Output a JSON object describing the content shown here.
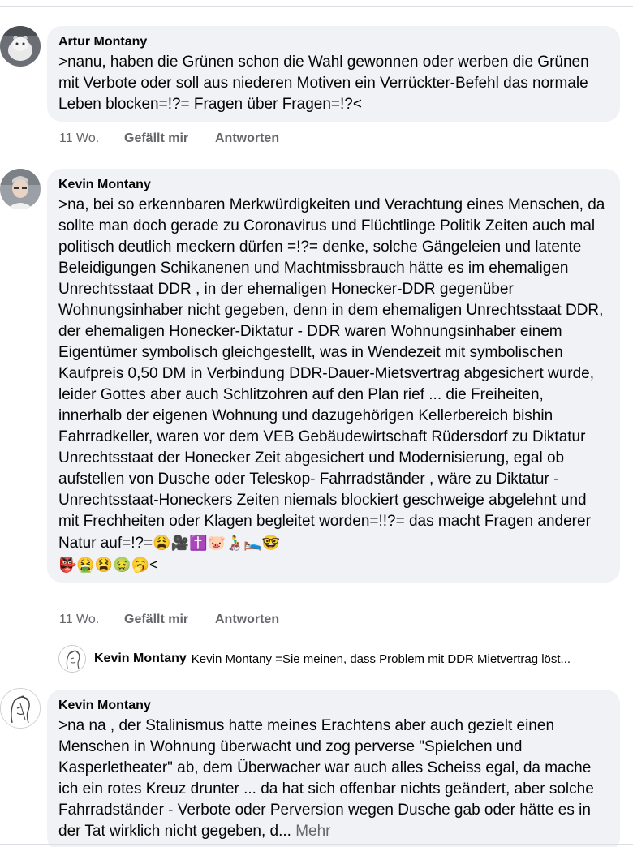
{
  "comments": [
    {
      "author": "Artur Montany",
      "text": ">nanu, haben die Grünen schon die Wahl gewonnen oder werben die Grünen mit Verbote oder soll aus niederen Motiven  ein Verrückter-Befehl das normale Leben blocken=!?= Fragen über Fragen=!?<",
      "time": "11 Wo.",
      "like": "Gefällt mir",
      "reply": "Antworten"
    },
    {
      "author": "Kevin Montany",
      "text": ">na, bei so erkennbaren Merkwürdigkeiten und Verachtung eines Menschen, da sollte man doch gerade zu Coronavirus und Flüchtlinge Politik Zeiten  auch mal politisch deutlich meckern dürfen =!?= denke, solche Gängeleien und latente Beleidigungen Schikanenen und Machtmissbrauch  hätte es im ehemaligen Unrechtsstaat DDR  , in der ehemaligen Honecker-DDR gegenüber Wohnungsinhaber nicht gegeben, denn in dem ehemaligen Unrechtsstaat DDR, der ehemaligen Honecker-Diktatur - DDR waren Wohnungsinhaber einem Eigentümer symbolisch gleichgestellt, was in Wendezeit mit symbolischen  Kaufpreis 0,50  DM in Verbindung DDR-Dauer-Mietsvertrag abgesichert wurde, leider Gottes aber auch Schlitzohren auf den Plan rief  ... die Freiheiten,  innerhalb der eigenen Wohnung und dazugehörigen Kellerbereich bishin Fahrradkeller, waren vor dem VEB Gebäudewirtschaft Rüdersdorf zu  Diktatur Unrechtsstaat der Honecker Zeit  abgesichert und Modernisierung, egal ob aufstellen von Dusche oder Teleskop- Fahrradständer ,  wäre zu Diktatur - Unrechtsstaat-Honeckers Zeiten  niemals blockiert geschweige abgelehnt und mit Frechheiten oder Klagen begleitet worden=!!?= das macht Fragen anderer Natur auf=!?=",
      "emoji_tail": "😩🎥✝️🐷👨‍🦽🛌🤓",
      "emoji_tail2": "👺🤮😫🤢🥱<",
      "time": "11 Wo.",
      "like": "Gefällt mir",
      "reply": "Antworten"
    },
    {
      "author": "Kevin Montany",
      "text": ">na na , der Stalinismus hatte meines Erachtens  aber auch gezielt einen Menschen  in Wohnung überwacht und zog perverse \"Spielchen und Kasperletheater\" ab, dem Überwacher war auch alles Scheiss egal, da mache ich ein rotes Kreuz drunter ... da hat sich offenbar nichts geändert, aber solche Fahrradständer - Verbote oder Perversion wegen Dusche gab oder hätte es in der Tat wirklich nicht gegeben, d...",
      "more": "Mehr"
    }
  ],
  "reply_preview": {
    "author": "Kevin Montany",
    "text": "Kevin Montany =Sie meinen, dass Problem mit DDR Mietvertrag löst..."
  }
}
